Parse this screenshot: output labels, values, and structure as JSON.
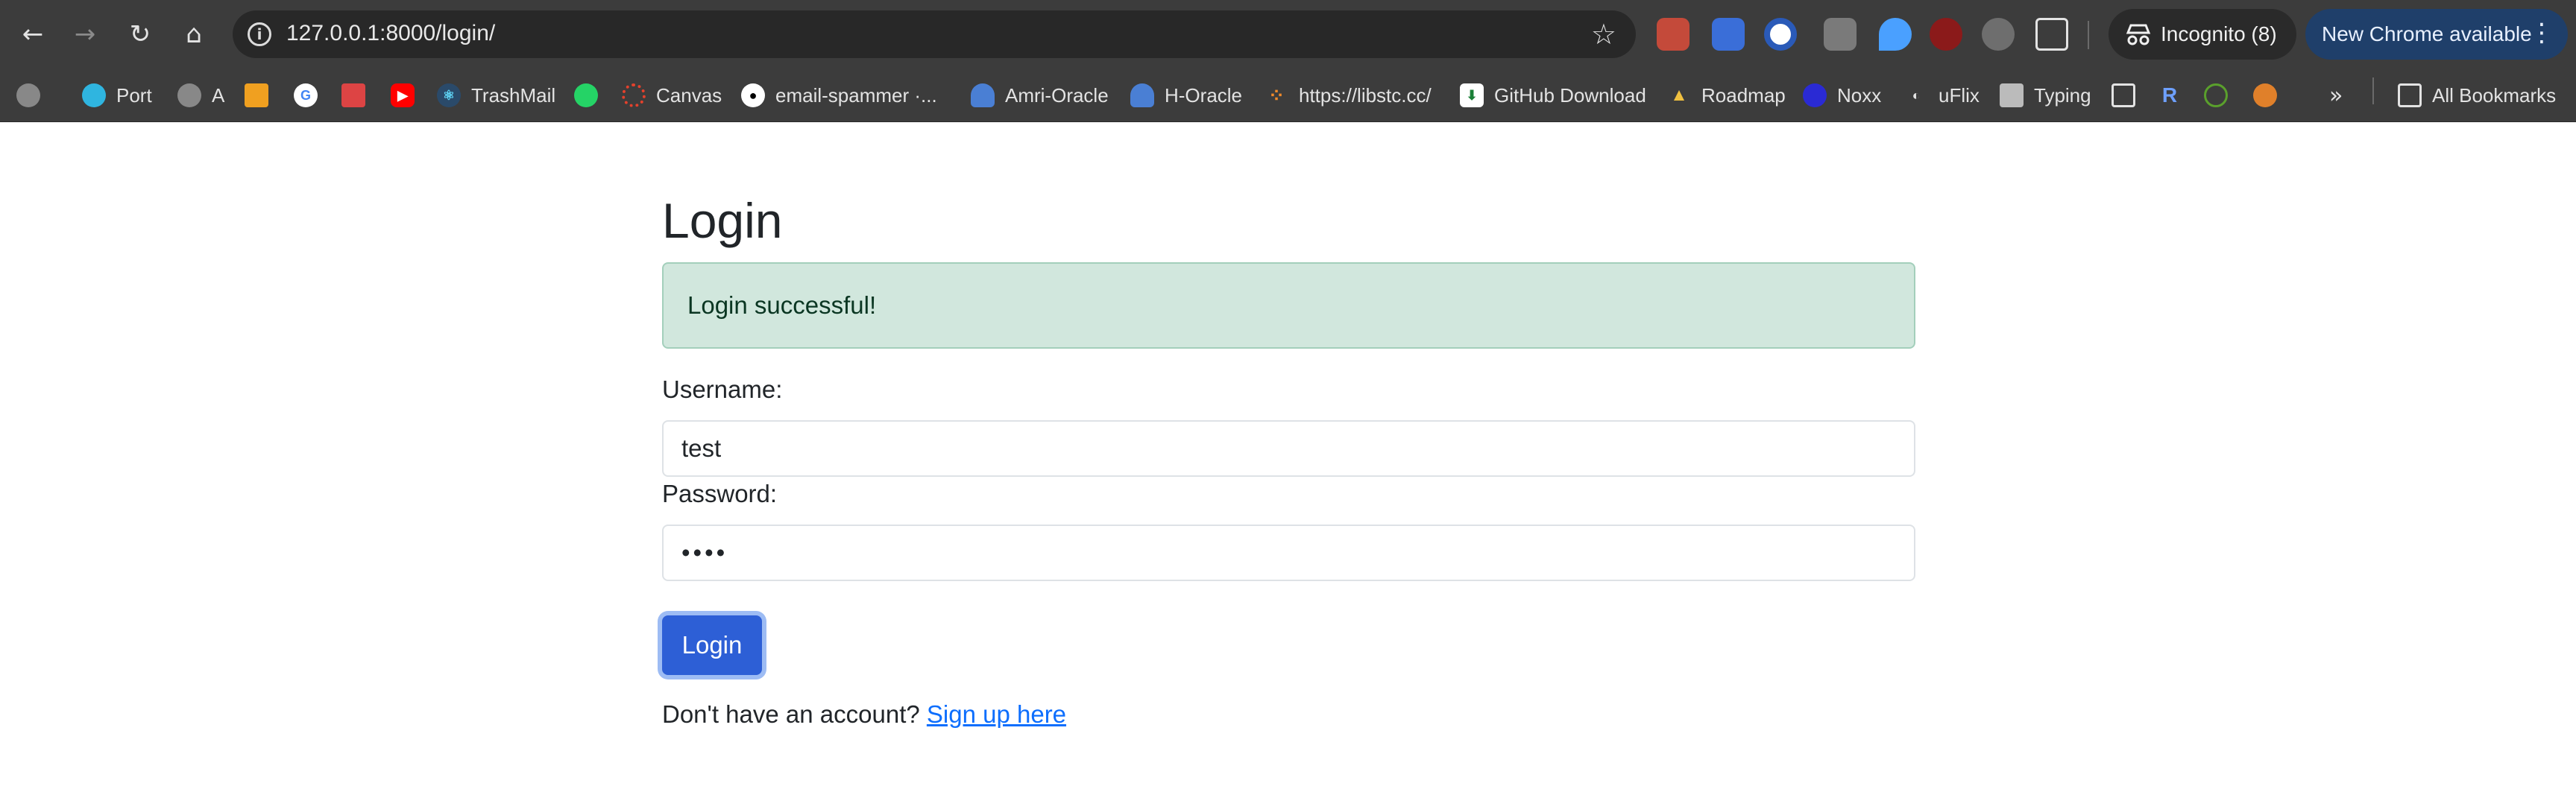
{
  "browser": {
    "url": "127.0.0.1:8000/login/",
    "incognito_label": "Incognito (8)",
    "update_label": "New Chrome available",
    "bookmarks": [
      {
        "label": "Port",
        "icon": "port-icon"
      },
      {
        "label": "A",
        "icon": "globe-icon"
      },
      {
        "label": "",
        "icon": "arrow-square-icon"
      },
      {
        "label": "",
        "icon": "google-icon"
      },
      {
        "label": "",
        "icon": "photos-icon"
      },
      {
        "label": "",
        "icon": "youtube-icon"
      },
      {
        "label": "TrashMail",
        "icon": "react-icon"
      },
      {
        "label": "",
        "icon": "whatsapp-icon"
      },
      {
        "label": "Canvas",
        "icon": "canvas-icon"
      },
      {
        "label": "email-spammer ·...",
        "icon": "github-icon"
      },
      {
        "label": "Amri-Oracle",
        "icon": "cloud-icon"
      },
      {
        "label": "H-Oracle",
        "icon": "cloud-icon"
      },
      {
        "label": "https://libstc.cc/",
        "icon": "network-icon"
      },
      {
        "label": "GitHub Download",
        "icon": "download-icon"
      },
      {
        "label": "Roadmap",
        "icon": "rocket-icon"
      },
      {
        "label": "Noxx",
        "icon": "noxx-icon"
      },
      {
        "label": "uFlix",
        "icon": "uflix-icon"
      },
      {
        "label": "Typing",
        "icon": "typewriter-icon"
      }
    ],
    "all_bookmarks_label": "All Bookmarks"
  },
  "page": {
    "title": "Login",
    "alert": "Login successful!",
    "username_label": "Username:",
    "username_value": "test",
    "password_label": "Password:",
    "password_value": "••••",
    "submit_label": "Login",
    "signup_prompt": "Don't have an account?",
    "signup_link": "Sign up here"
  },
  "colors": {
    "alert_bg": "#d1e7dd",
    "button_bg": "#2d5fd6",
    "link": "#0d6efd"
  }
}
